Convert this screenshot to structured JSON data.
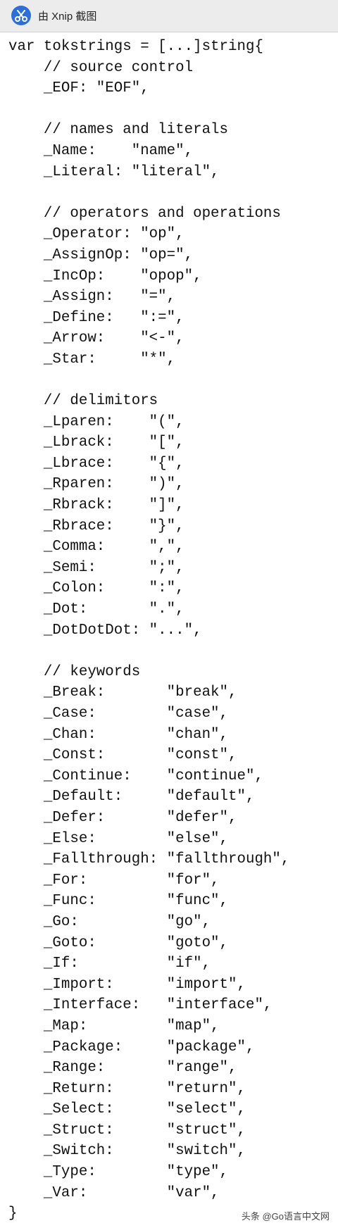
{
  "window": {
    "title": "由 Xnip 截图",
    "icon": "xnip-scissors-icon",
    "accent_color": "#2d6fd6"
  },
  "code": {
    "language": "go",
    "lines": [
      "var tokstrings = [...]string{",
      "    // source control",
      "    _EOF: \"EOF\",",
      "",
      "    // names and literals",
      "    _Name:    \"name\",",
      "    _Literal: \"literal\",",
      "",
      "    // operators and operations",
      "    _Operator: \"op\",",
      "    _AssignOp: \"op=\",",
      "    _IncOp:    \"opop\",",
      "    _Assign:   \"=\",",
      "    _Define:   \":=\",",
      "    _Arrow:    \"<-\",",
      "    _Star:     \"*\",",
      "",
      "    // delimitors",
      "    _Lparen:    \"(\",",
      "    _Lbrack:    \"[\",",
      "    _Lbrace:    \"{\",",
      "    _Rparen:    \")\",",
      "    _Rbrack:    \"]\",",
      "    _Rbrace:    \"}\",",
      "    _Comma:     \",\",",
      "    _Semi:      \";\",",
      "    _Colon:     \":\",",
      "    _Dot:       \".\",",
      "    _DotDotDot: \"...\",",
      "",
      "    // keywords",
      "    _Break:       \"break\",",
      "    _Case:        \"case\",",
      "    _Chan:        \"chan\",",
      "    _Const:       \"const\",",
      "    _Continue:    \"continue\",",
      "    _Default:     \"default\",",
      "    _Defer:       \"defer\",",
      "    _Else:        \"else\",",
      "    _Fallthrough: \"fallthrough\",",
      "    _For:         \"for\",",
      "    _Func:        \"func\",",
      "    _Go:          \"go\",",
      "    _Goto:        \"goto\",",
      "    _If:          \"if\",",
      "    _Import:      \"import\",",
      "    _Interface:   \"interface\",",
      "    _Map:         \"map\",",
      "    _Package:     \"package\",",
      "    _Range:       \"range\",",
      "    _Return:      \"return\",",
      "    _Select:      \"select\",",
      "    _Struct:      \"struct\",",
      "    _Switch:      \"switch\",",
      "    _Type:        \"type\",",
      "    _Var:         \"var\",",
      "}"
    ]
  },
  "watermark": {
    "text": "头条 @Go语言中文网"
  }
}
